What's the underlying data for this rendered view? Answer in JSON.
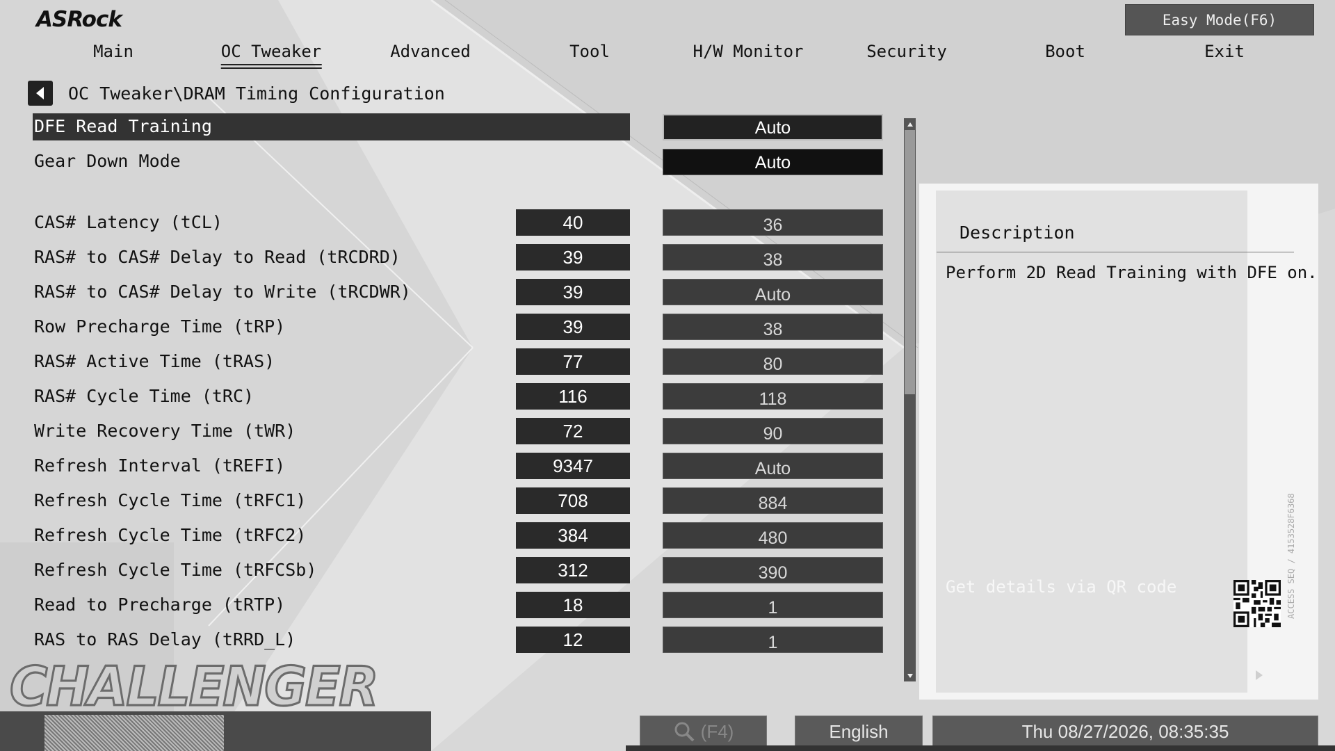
{
  "brand": "ASRock",
  "easy_mode_label": "Easy Mode(F6)",
  "menu": [
    {
      "label": "Main",
      "active": false
    },
    {
      "label": "OC Tweaker",
      "active": true
    },
    {
      "label": "Advanced",
      "active": false
    },
    {
      "label": "Tool",
      "active": false
    },
    {
      "label": "H/W Monitor",
      "active": false
    },
    {
      "label": "Security",
      "active": false
    },
    {
      "label": "Boot",
      "active": false
    },
    {
      "label": "Exit",
      "active": false
    }
  ],
  "breadcrumb": "OC Tweaker\\DRAM Timing Configuration",
  "settings_top": [
    {
      "label": "DFE Read Training",
      "value": "Auto",
      "selected": true
    },
    {
      "label": "Gear Down Mode",
      "value": "Auto",
      "selected": false
    }
  ],
  "timings": [
    {
      "label": "CAS# Latency (tCL)",
      "current": "40",
      "value": "36"
    },
    {
      "label": "RAS# to CAS# Delay to Read  (tRCDRD)",
      "current": "39",
      "value": "38"
    },
    {
      "label": "RAS# to CAS# Delay to Write  (tRCDWR)",
      "current": "39",
      "value": "Auto"
    },
    {
      "label": "Row Precharge Time (tRP)",
      "current": "39",
      "value": "38"
    },
    {
      "label": "RAS# Active Time (tRAS)",
      "current": "77",
      "value": "80"
    },
    {
      "label": "RAS# Cycle Time (tRC)",
      "current": "116",
      "value": "118"
    },
    {
      "label": "Write Recovery Time (tWR)",
      "current": "72",
      "value": "90"
    },
    {
      "label": "Refresh Interval (tREFI)",
      "current": "9347",
      "value": "Auto"
    },
    {
      "label": "Refresh Cycle Time (tRFC1)",
      "current": "708",
      "value": "884"
    },
    {
      "label": "Refresh Cycle Time (tRFC2)",
      "current": "384",
      "value": "480"
    },
    {
      "label": "Refresh Cycle Time (tRFCSb)",
      "current": "312",
      "value": "390"
    },
    {
      "label": "Read to Precharge (tRTP)",
      "current": "18",
      "value": "1"
    },
    {
      "label": "RAS to RAS Delay (tRRD_L)",
      "current": "12",
      "value": "1"
    }
  ],
  "description": {
    "title": "Description",
    "text": "Perform 2D Read Training with DFE on.",
    "qr_hint": "Get details via QR code",
    "vertical_code": "ACCESS SEQ / 4153528F6368"
  },
  "footer": {
    "search_label": "(F4)",
    "language": "English",
    "datetime": "Thu 08/27/2026, 08:35:35",
    "watermark": "CHALLENGER"
  },
  "colors": {
    "background": "#d6d6d6",
    "selected_row": "#333333",
    "value_box": "#3c3c3c",
    "current_box": "#2a2a2a",
    "panel": "#f4f4f4"
  }
}
